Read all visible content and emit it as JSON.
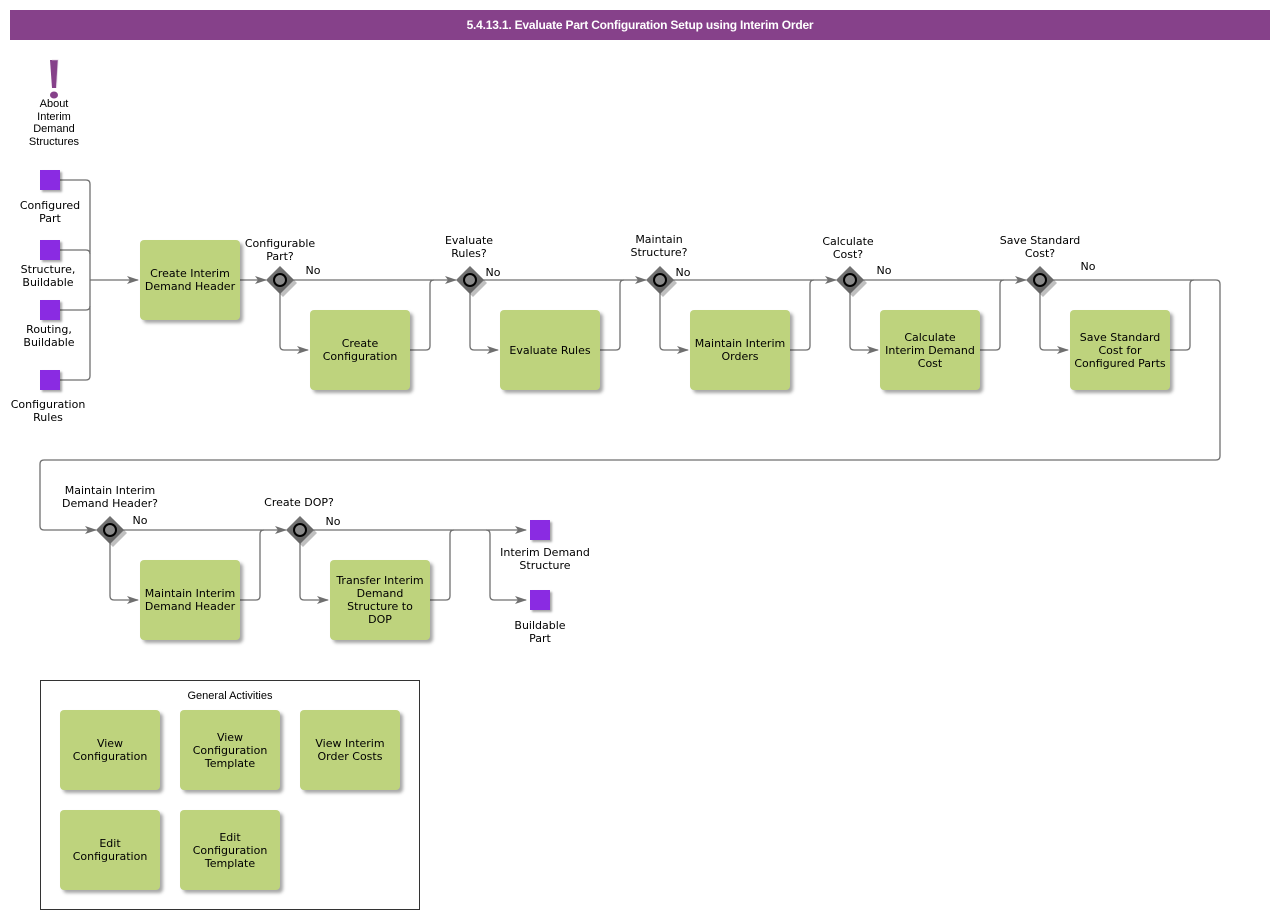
{
  "title": "5.4.13.1. Evaluate Part Configuration Setup using Interim Order",
  "colors": {
    "title_bar": "#86418a",
    "task_fill": "#bed37d",
    "data_object": "#8a2be2",
    "gateway": "#6f6f6f",
    "connector": "#6f6f6f"
  },
  "annotation": {
    "icon": "exclamation-icon",
    "label": "About\nInterim\nDemand\nStructures"
  },
  "inputs": [
    {
      "label": "Configured\nPart"
    },
    {
      "label": "Structure,\nBuildable"
    },
    {
      "label": "Routing,\nBuildable"
    },
    {
      "label": "Configuration\nRules"
    }
  ],
  "start_task": {
    "label": "Create Interim\nDemand Header"
  },
  "row1_gateways": [
    {
      "question": "Configurable\nPart?",
      "no_label": "No",
      "task": "Create\nConfiguration"
    },
    {
      "question": "Evaluate\nRules?",
      "no_label": "No",
      "task": "Evaluate Rules"
    },
    {
      "question": "Maintain\nStructure?",
      "no_label": "No",
      "task": "Maintain Interim\nOrders"
    },
    {
      "question": "Calculate\nCost?",
      "no_label": "No",
      "task": "Calculate\nInterim Demand\nCost"
    },
    {
      "question": "Save Standard\nCost?",
      "no_label": "No",
      "task": "Save Standard\nCost for\nConfigured Parts"
    }
  ],
  "row2_gateways": [
    {
      "question": "Maintain Interim\nDemand Header?",
      "no_label": "No",
      "task": "Maintain Interim\nDemand Header"
    },
    {
      "question": "Create DOP?",
      "no_label": "No",
      "task": "Transfer Interim\nDemand\nStructure to\nDOP"
    }
  ],
  "outputs": [
    {
      "label": "Interim Demand\nStructure"
    },
    {
      "label": "Buildable\nPart"
    }
  ],
  "general_activities": {
    "title": "General Activities",
    "items": [
      {
        "label": "View\nConfiguration"
      },
      {
        "label": "View\nConfiguration\nTemplate"
      },
      {
        "label": "View Interim\nOrder Costs"
      },
      {
        "label": "Edit\nConfiguration"
      },
      {
        "label": "Edit\nConfiguration\nTemplate"
      }
    ]
  }
}
